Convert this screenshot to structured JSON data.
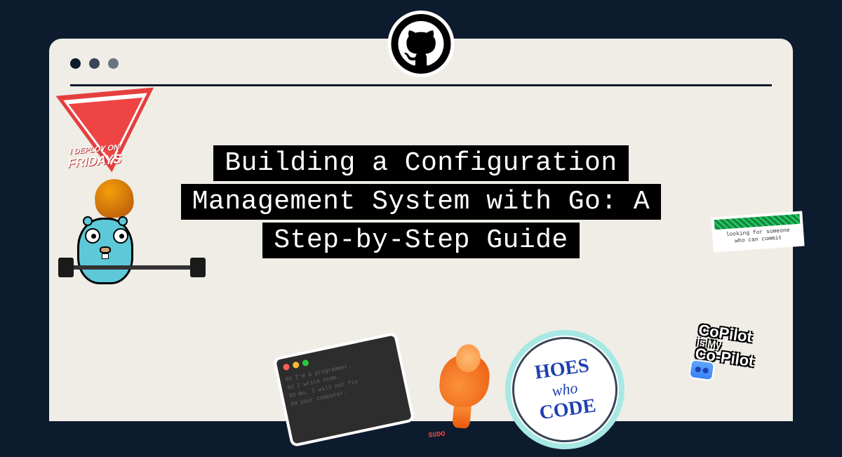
{
  "title": {
    "line1": "Building a Configuration",
    "line2": "Management System with Go: A",
    "line3": "Step-by-Step Guide"
  },
  "stickers": {
    "friday": {
      "line1": "I DEPLOY ON",
      "line2": "FRIDAYS"
    },
    "terminal": {
      "line1": "I'm a programmer.",
      "line2": "I write code.",
      "line3": "No, I will not fix",
      "line4": "your computer."
    },
    "sudo": "SUDO",
    "hoes": {
      "top": "HOES",
      "mid": "who",
      "bot": "CODE"
    },
    "commit": {
      "line1": "looking for someone",
      "line2": "who can commit"
    },
    "copilot": {
      "line1": "CoPilot",
      "line2": "is My",
      "line3": "Co-Pilot"
    }
  }
}
